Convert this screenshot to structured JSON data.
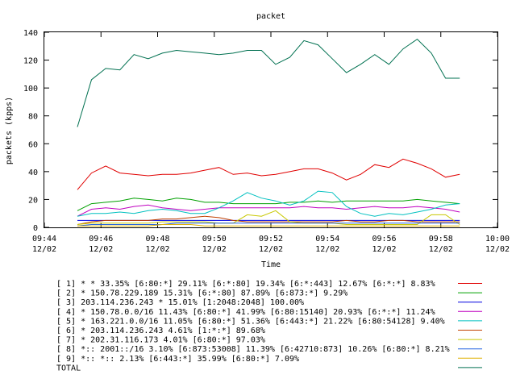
{
  "chart_data": {
    "type": "line",
    "title": "packet",
    "xlabel": "Time",
    "ylabel": "packets (kpps)",
    "ylim": [
      0,
      140
    ],
    "xlim": [
      "09:44",
      "10:00"
    ],
    "grid": false,
    "legend_placement": "bottom",
    "y_ticks": [
      "0",
      "20",
      "40",
      "60",
      "80",
      "100",
      "120",
      "140"
    ],
    "x_ticks": [
      {
        "time": "09:44",
        "date": "12/02"
      },
      {
        "time": "09:46",
        "date": "12/02"
      },
      {
        "time": "09:48",
        "date": "12/02"
      },
      {
        "time": "09:50",
        "date": "12/02"
      },
      {
        "time": "09:52",
        "date": "12/02"
      },
      {
        "time": "09:54",
        "date": "12/02"
      },
      {
        "time": "09:56",
        "date": "12/02"
      },
      {
        "time": "09:58",
        "date": "12/02"
      },
      {
        "time": "10:00",
        "date": "12/02"
      }
    ],
    "x": [
      "09:45:10",
      "09:45:40",
      "09:46:10",
      "09:46:40",
      "09:47:10",
      "09:47:40",
      "09:48:10",
      "09:48:40",
      "09:49:10",
      "09:49:40",
      "09:50:10",
      "09:50:40",
      "09:51:10",
      "09:51:40",
      "09:52:10",
      "09:52:40",
      "09:53:10",
      "09:53:40",
      "09:54:10",
      "09:54:40",
      "09:55:10",
      "09:55:40",
      "09:56:10",
      "09:56:40",
      "09:57:10",
      "09:57:40",
      "09:58:10",
      "09:58:40"
    ],
    "series": [
      {
        "name": "[ 1] * * 33.35%  [6:80:*] 29.11% [6:*:80] 19.34% [6:*:443] 12.67% [6:*:*] 8.83%",
        "color": "#e00000",
        "values": [
          27,
          39,
          44,
          39,
          38,
          37,
          38,
          38,
          39,
          41,
          43,
          38,
          39,
          37,
          38,
          40,
          42,
          42,
          39,
          34,
          38,
          45,
          43,
          49,
          46,
          42,
          36,
          38
        ]
      },
      {
        "name": "[ 2] * 150.78.229.189 15.31%  [6:*:80] 87.89% [6:873:*] 9.29%",
        "color": "#00a000",
        "values": [
          12,
          17,
          18,
          19,
          21,
          20,
          19,
          21,
          20,
          18,
          18,
          17,
          17,
          17,
          17,
          18,
          18,
          19,
          18,
          19,
          19,
          19,
          19,
          19,
          20,
          19,
          18,
          17
        ]
      },
      {
        "name": "[ 3] 203.114.236.243 * 15.01%  [1:2048:2048] 100.00%",
        "color": "#0000e0",
        "values": [
          5,
          5,
          5,
          5,
          5,
          5,
          5,
          5,
          5,
          5,
          5,
          5,
          5,
          5,
          5,
          5,
          5,
          5,
          5,
          5,
          5,
          5,
          5,
          5,
          5,
          5,
          5,
          5
        ]
      },
      {
        "name": "[ 4] * 150.78.0.0/16 11.43%  [6:80:*] 41.99% [6:80:15140] 20.93% [6:*:*] 11.24%",
        "color": "#c000c0",
        "values": [
          8,
          13,
          14,
          13,
          15,
          16,
          14,
          13,
          12,
          13,
          14,
          14,
          14,
          14,
          14,
          14,
          15,
          14,
          14,
          13,
          14,
          15,
          14,
          14,
          15,
          14,
          13,
          11
        ]
      },
      {
        "name": "[ 5] * 163.221.0.0/16 11.05%  [6:80:*] 51.36% [6:443:*] 21.22% [6:80:54128] 9.40%",
        "color": "#00c0c0",
        "values": [
          8,
          10,
          10,
          11,
          10,
          12,
          13,
          12,
          10,
          10,
          14,
          19,
          25,
          21,
          19,
          16,
          19,
          26,
          25,
          15,
          10,
          8,
          10,
          9,
          11,
          13,
          16,
          17
        ]
      },
      {
        "name": "[ 6] * 203.114.236.243 4.61%  [1:*:*] 89.68%",
        "color": "#c04000",
        "values": [
          2,
          4,
          5,
          5,
          5,
          5,
          6,
          6,
          7,
          8,
          7,
          5,
          4,
          4,
          4,
          4,
          4,
          4,
          4,
          5,
          4,
          4,
          5,
          5,
          4,
          4,
          4,
          4
        ]
      },
      {
        "name": "[ 7] * 202.31.116.173 4.01%  [6:80:*] 97.03%",
        "color": "#c8c800",
        "values": [
          2,
          3,
          3,
          3,
          3,
          3,
          4,
          4,
          4,
          4,
          3,
          3,
          9,
          8,
          12,
          4,
          3,
          3,
          3,
          2,
          2,
          2,
          2,
          2,
          2,
          9,
          9,
          2
        ]
      },
      {
        "name": "[ 8] *:: 2001::/16 3.10%  [6:873:53008] 11.39% [6:42710:873] 10.26% [6:80:*] 8.21%",
        "color": "#2060e0",
        "values": [
          1,
          2,
          2,
          2,
          2,
          2,
          2,
          3,
          3,
          3,
          3,
          3,
          3,
          3,
          3,
          3,
          3,
          3,
          3,
          3,
          3,
          3,
          3,
          3,
          3,
          3,
          3,
          3
        ]
      },
      {
        "name": "[ 9] *:: *:: 2.13%  [6:443:*] 35.99% [6:80:*] 7.09%",
        "color": "#e0b000",
        "values": [
          1,
          1,
          1,
          1,
          1,
          1,
          2,
          2,
          2,
          1,
          1,
          1,
          1,
          1,
          1,
          1,
          1,
          1,
          1,
          1,
          1,
          1,
          1,
          1,
          1,
          1,
          1,
          1
        ]
      },
      {
        "name": "TOTAL",
        "color": "#007050",
        "values": [
          72,
          106,
          114,
          113,
          124,
          121,
          125,
          127,
          126,
          125,
          124,
          125,
          127,
          127,
          117,
          122,
          134,
          131,
          121,
          111,
          117,
          124,
          117,
          128,
          135,
          125,
          107,
          107
        ]
      }
    ]
  }
}
